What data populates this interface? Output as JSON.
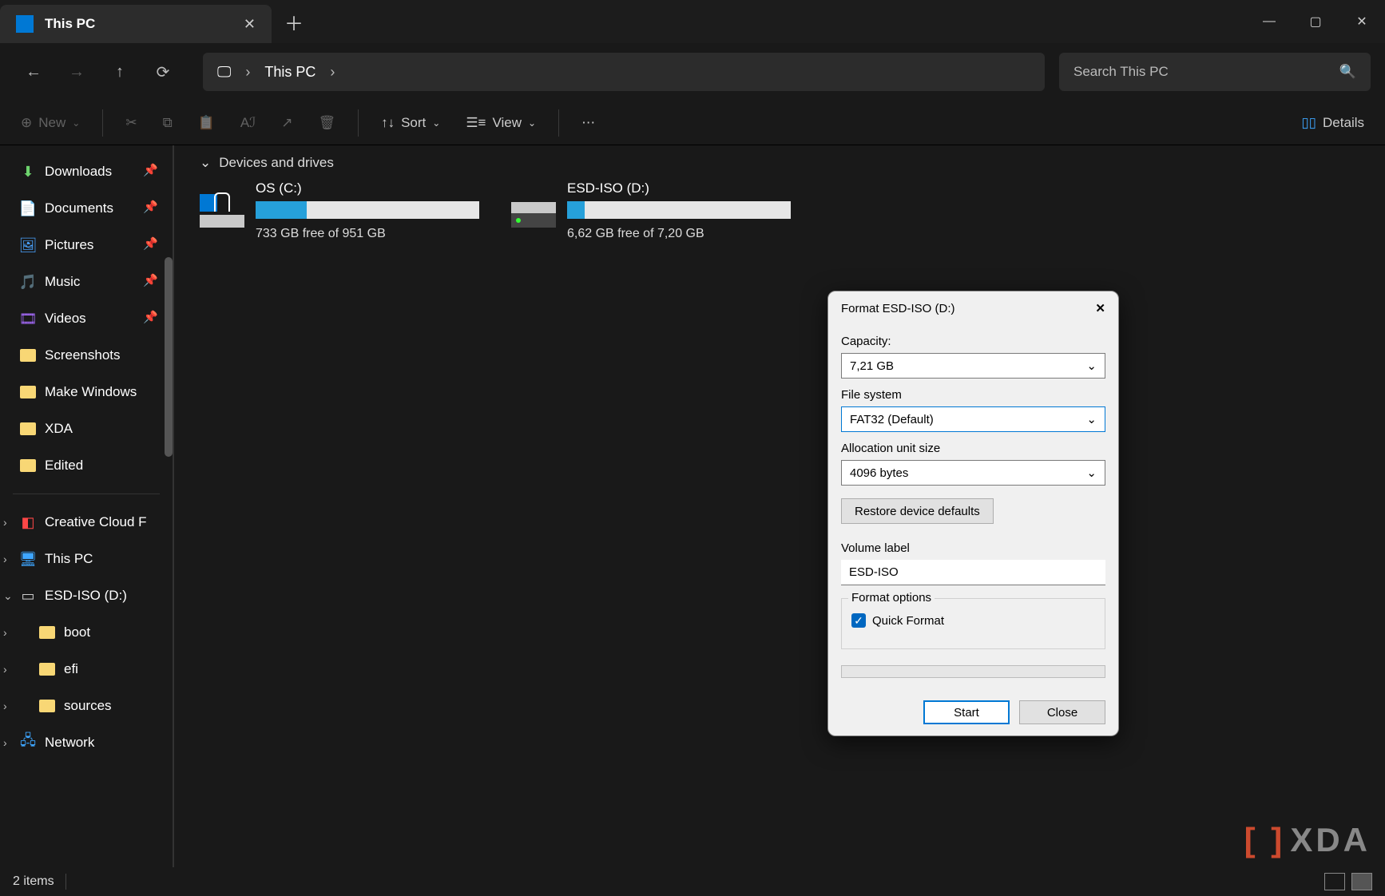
{
  "window": {
    "tab_title": "This PC",
    "address": {
      "root_icon": "monitor",
      "path": "This PC"
    },
    "search_placeholder": "Search This PC"
  },
  "toolbar": {
    "new_label": "New",
    "sort_label": "Sort",
    "view_label": "View",
    "details_label": "Details"
  },
  "sidebar": {
    "quick": [
      {
        "label": "Downloads",
        "icon": "download",
        "pinned": true
      },
      {
        "label": "Documents",
        "icon": "document",
        "pinned": true
      },
      {
        "label": "Pictures",
        "icon": "pictures",
        "pinned": true
      },
      {
        "label": "Music",
        "icon": "music",
        "pinned": true
      },
      {
        "label": "Videos",
        "icon": "videos",
        "pinned": true
      },
      {
        "label": "Screenshots",
        "icon": "folder"
      },
      {
        "label": "Make Windows",
        "icon": "folder"
      },
      {
        "label": "XDA",
        "icon": "folder"
      },
      {
        "label": "Edited",
        "icon": "folder"
      }
    ],
    "tree": [
      {
        "label": "Creative Cloud F",
        "icon": "cc",
        "expandable": true,
        "expanded": false
      },
      {
        "label": "This PC",
        "icon": "pc",
        "expandable": true,
        "expanded": false
      },
      {
        "label": "ESD-ISO (D:)",
        "icon": "drive",
        "expandable": true,
        "expanded": true,
        "children": [
          {
            "label": "boot"
          },
          {
            "label": "efi"
          },
          {
            "label": "sources"
          }
        ]
      },
      {
        "label": "Network",
        "icon": "network",
        "expandable": true,
        "expanded": false
      }
    ]
  },
  "content": {
    "group_header": "Devices and drives",
    "drives": [
      {
        "name": "OS (C:)",
        "subtitle": "733 GB free of 951 GB",
        "fill_pct": 23,
        "icon": "os-drive"
      },
      {
        "name": "ESD-ISO (D:)",
        "subtitle": "6,62 GB free of 7,20 GB",
        "fill_pct": 8,
        "icon": "usb-drive"
      }
    ]
  },
  "dialog": {
    "title": "Format ESD-ISO (D:)",
    "capacity_label": "Capacity:",
    "capacity_value": "7,21 GB",
    "filesystem_label": "File system",
    "filesystem_value": "FAT32 (Default)",
    "allocation_label": "Allocation unit size",
    "allocation_value": "4096 bytes",
    "restore_label": "Restore device defaults",
    "volume_label": "Volume label",
    "volume_value": "ESD-ISO",
    "options_label": "Format options",
    "quick_format_label": "Quick Format",
    "quick_format_checked": true,
    "start_label": "Start",
    "close_label": "Close"
  },
  "statusbar": {
    "text": "2 items"
  },
  "watermark": {
    "text": "XDA"
  }
}
